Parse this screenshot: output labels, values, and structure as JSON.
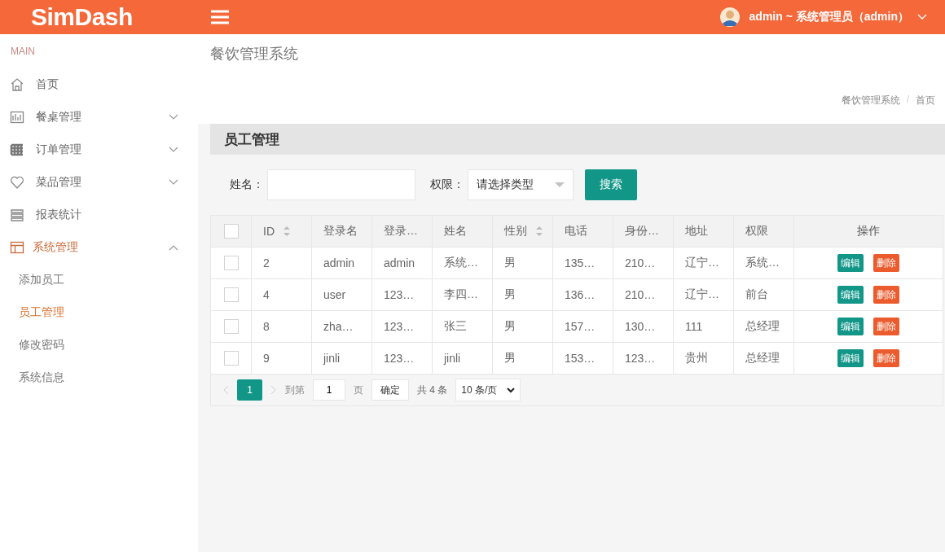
{
  "header": {
    "logo": "SimDash",
    "user": "admin ~ 系统管理员（admin）"
  },
  "sidebar": {
    "section": "MAIN",
    "items": [
      {
        "label": "首页",
        "selected": false
      },
      {
        "label": "餐桌管理",
        "expanded": false,
        "selected": false
      },
      {
        "label": "订单管理",
        "expanded": false,
        "selected": false
      },
      {
        "label": "菜品管理",
        "expanded": false,
        "selected": false
      },
      {
        "label": "报表统计",
        "selected": false
      },
      {
        "label": "系统管理",
        "expanded": true,
        "selected": true,
        "children": [
          {
            "label": "添加员工",
            "selected": false
          },
          {
            "label": "员工管理",
            "selected": true
          },
          {
            "label": "修改密码",
            "selected": false
          },
          {
            "label": "系统信息",
            "selected": false
          }
        ]
      }
    ]
  },
  "page": {
    "title": "餐饮管理系统",
    "breadcrumb": [
      "餐饮管理系统",
      "首页"
    ],
    "breadcrumb_separator": "/"
  },
  "card": {
    "title": "员工管理",
    "filters": {
      "name_label": "姓名：",
      "role_label": "权限：",
      "role_placeholder": "请选择类型",
      "search_button": "搜索"
    },
    "table": {
      "header_checked": false,
      "columns": [
        {
          "label": "ID",
          "sortable": true
        },
        {
          "label": "登录名"
        },
        {
          "label": "登录…"
        },
        {
          "label": "姓名"
        },
        {
          "label": "性别",
          "sortable": true
        },
        {
          "label": "电话"
        },
        {
          "label": "身份…"
        },
        {
          "label": "地址"
        },
        {
          "label": "权限"
        },
        {
          "label": "操作"
        }
      ],
      "rows": [
        {
          "checked": false,
          "cells": [
            "2",
            "admin",
            "admin",
            "系统…",
            "男",
            "135…",
            "210…",
            "辽宁…",
            "系统…"
          ],
          "actions": [
            "编辑",
            "删除"
          ]
        },
        {
          "checked": false,
          "cells": [
            "4",
            "user",
            "123…",
            "李四…",
            "男",
            "136…",
            "210…",
            "辽宁…",
            "前台"
          ],
          "actions": [
            "编辑",
            "删除"
          ]
        },
        {
          "checked": false,
          "cells": [
            "8",
            "zha…",
            "123…",
            "张三",
            "男",
            "157…",
            "130…",
            "111",
            "总经理"
          ],
          "actions": [
            "编辑",
            "删除"
          ]
        },
        {
          "checked": false,
          "cells": [
            "9",
            "jinli",
            "123…",
            "jinli",
            "男",
            "153…",
            "123…",
            "贵州",
            "总经理"
          ],
          "actions": [
            "编辑",
            "删除"
          ]
        }
      ]
    },
    "pagination": {
      "pages": [
        {
          "label": "1",
          "selected": true
        }
      ],
      "goto_label": "到第",
      "goto_value": "1",
      "page_unit": "页",
      "confirm": "确定",
      "total": "共 4 条",
      "page_size": "10 条/页"
    }
  }
}
